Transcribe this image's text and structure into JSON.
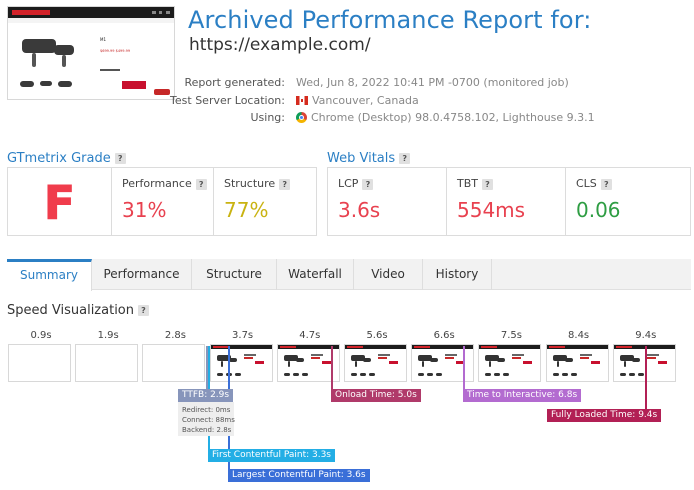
{
  "header": {
    "title": "Archived Performance Report for:",
    "url": "https://example.com/",
    "meta": [
      {
        "label": "Report generated:",
        "value": "Wed, Jun 8, 2022 10:41 PM -0700 (monitored job)",
        "icon": ""
      },
      {
        "label": "Test Server Location:",
        "value": "Vancouver, Canada",
        "icon": "canada-flag-icon"
      },
      {
        "label": "Using:",
        "value": "Chrome (Desktop) 98.0.4758.102, Lighthouse 9.3.1",
        "icon": "chrome-icon"
      }
    ],
    "thumb": {
      "product": "M1",
      "price": "$699.99 $499.99"
    }
  },
  "grade": {
    "title": "GTmetrix Grade",
    "help": "?",
    "letter": "F",
    "performance": {
      "label": "Performance",
      "value": "31%",
      "color": "#e8414f"
    },
    "structure": {
      "label": "Structure",
      "value": "77%",
      "color": "#c9b312"
    }
  },
  "vitals": {
    "title": "Web Vitals",
    "help": "?",
    "lcp": {
      "label": "LCP",
      "value": "3.6s",
      "color": "#e8414f"
    },
    "tbt": {
      "label": "TBT",
      "value": "554ms",
      "color": "#e8414f"
    },
    "cls": {
      "label": "CLS",
      "value": "0.06",
      "color": "#2e9d43"
    }
  },
  "tabs": [
    "Summary",
    "Performance",
    "Structure",
    "Waterfall",
    "Video",
    "History"
  ],
  "speed": {
    "title": "Speed Visualization",
    "help": "?",
    "ticks": [
      "0.9s",
      "1.9s",
      "2.8s",
      "3.7s",
      "4.7s",
      "5.6s",
      "6.6s",
      "7.5s",
      "8.4s",
      "9.4s"
    ],
    "frames_loaded": [
      false,
      false,
      false,
      true,
      true,
      true,
      true,
      true,
      true,
      true
    ],
    "markers": {
      "ttfb": {
        "label": "TTFB: 2.9s",
        "color": "#8795bb"
      },
      "ttfb_detail": {
        "redirect": "Redirect: 0ms",
        "connect": "Connect: 88ms",
        "backend": "Backend: 2.8s"
      },
      "fcp": {
        "label": "First Contentful Paint: 3.3s",
        "color": "#23aee5"
      },
      "lcp": {
        "label": "Largest Contentful Paint: 3.6s",
        "color": "#3a6fd8"
      },
      "onload": {
        "label": "Onload Time: 5.0s",
        "color": "#b03a6a"
      },
      "tti": {
        "label": "Time to Interactive: 6.8s",
        "color": "#b36bd0"
      },
      "fully": {
        "label": "Fully Loaded Time: 9.4s",
        "color": "#b22055"
      }
    }
  }
}
